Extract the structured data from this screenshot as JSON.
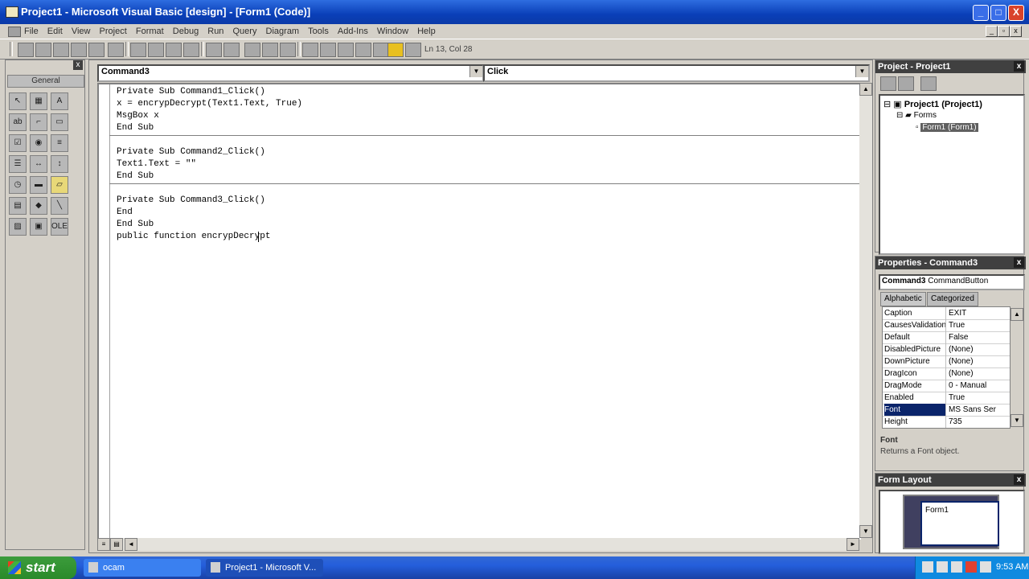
{
  "window": {
    "title": "Project1 - Microsoft Visual Basic [design] - [Form1 (Code)]",
    "minimize": "_",
    "maximize": "□",
    "close": "X"
  },
  "menu": [
    "File",
    "Edit",
    "View",
    "Project",
    "Format",
    "Debug",
    "Run",
    "Query",
    "Diagram",
    "Tools",
    "Add-Ins",
    "Window",
    "Help"
  ],
  "toolbar": {
    "position": "Ln 13, Col 28"
  },
  "toolbox": {
    "tab": "General",
    "close": "x"
  },
  "code": {
    "object_combo": "Command3",
    "procedure_combo": "Click",
    "lines": [
      "Private Sub Command1_Click()",
      "x = encrypDecrypt(Text1.Text, True)",
      "MsgBox x",
      "End Sub",
      "Private Sub Command2_Click()",
      "Text1.Text = \"\"",
      "End Sub",
      "Private Sub Command3_Click()",
      "End",
      "End Sub",
      "public function encrypDecrypt"
    ]
  },
  "project": {
    "title": "Project - Project1",
    "root": "Project1 (Project1)",
    "folder": "Forms",
    "item": "Form1 (Form1)"
  },
  "properties": {
    "title": "Properties - Command3",
    "object_name": "Command3",
    "object_type": "CommandButton",
    "tabs": [
      "Alphabetic",
      "Categorized"
    ],
    "rows": [
      {
        "name": "Caption",
        "value": "EXIT"
      },
      {
        "name": "CausesValidation",
        "value": "True"
      },
      {
        "name": "Default",
        "value": "False"
      },
      {
        "name": "DisabledPicture",
        "value": "(None)"
      },
      {
        "name": "DownPicture",
        "value": "(None)"
      },
      {
        "name": "DragIcon",
        "value": "(None)"
      },
      {
        "name": "DragMode",
        "value": "0 - Manual"
      },
      {
        "name": "Enabled",
        "value": "True"
      },
      {
        "name": "Font",
        "value": "MS Sans Ser"
      },
      {
        "name": "Height",
        "value": "735"
      }
    ],
    "selected_row": "Font",
    "desc_title": "Font",
    "desc_text": "Returns a Font object."
  },
  "layout": {
    "title": "Form Layout",
    "form_label": "Form1"
  },
  "taskbar": {
    "start": "start",
    "tasks": [
      "ocam",
      "Project1 - Microsoft V..."
    ],
    "clock": "9:53 AM"
  },
  "colors": {
    "titlebar": "#0a3fb8",
    "selection": "#0a246a",
    "panel_header": "#404040"
  }
}
